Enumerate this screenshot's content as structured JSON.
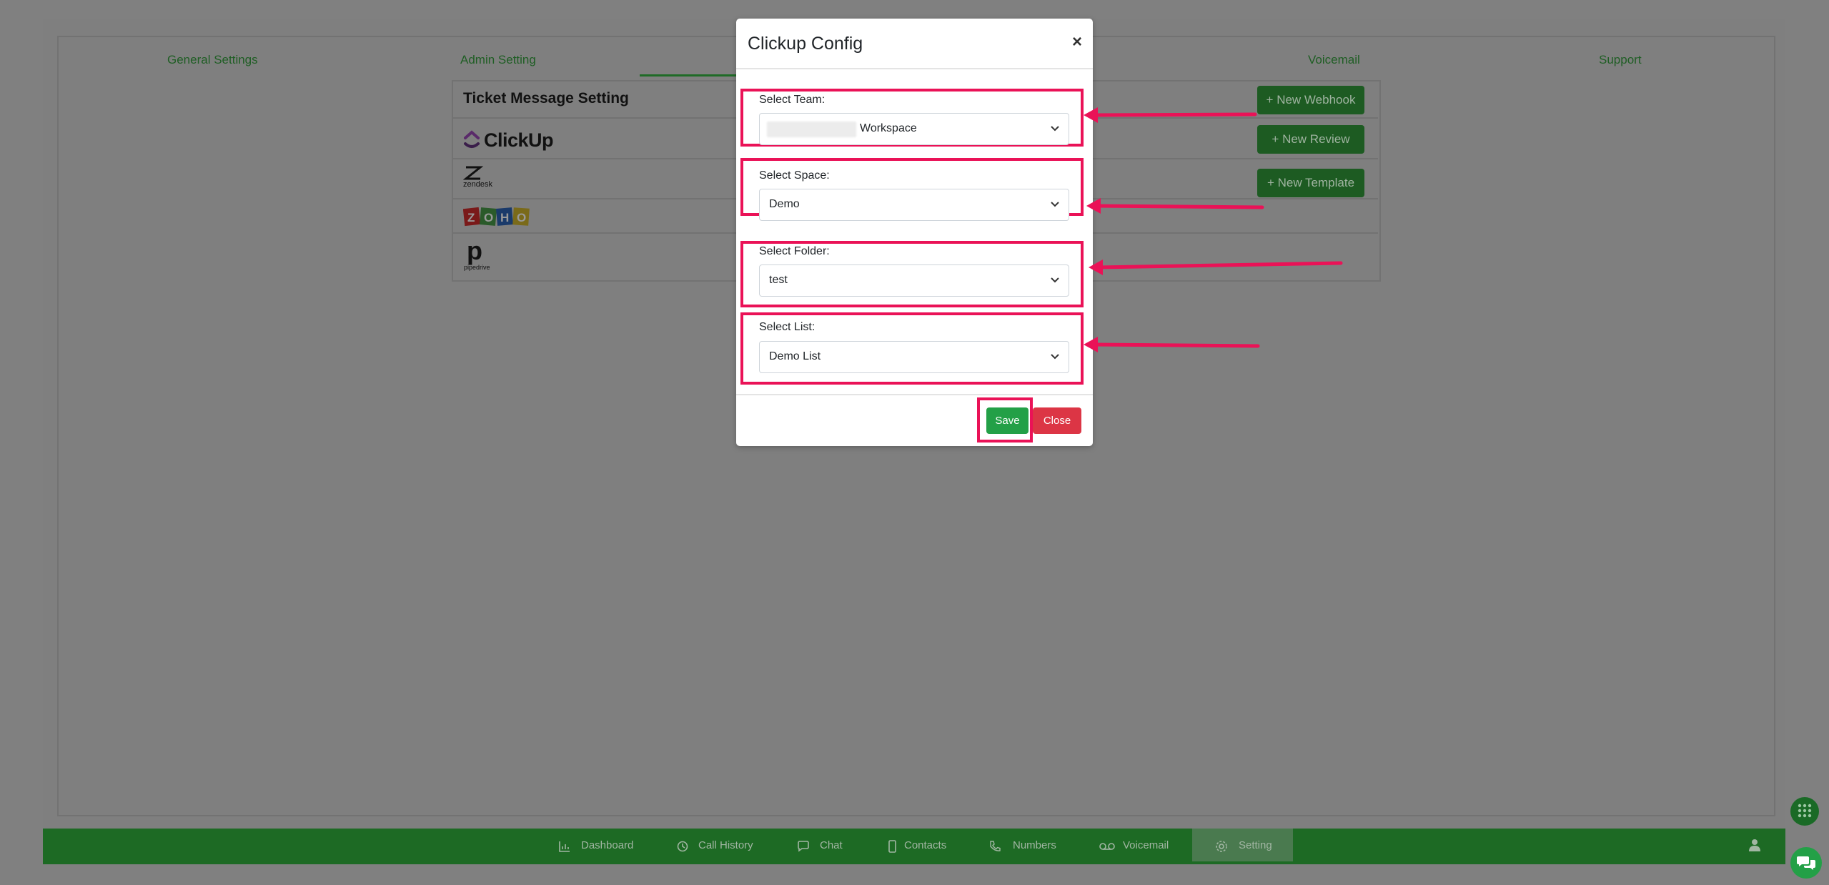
{
  "background_tabs": [
    "General Settings",
    "Admin Setting",
    "Voicemail",
    "Support"
  ],
  "ticket_card": {
    "title": "Ticket Message Setting",
    "integrations": [
      {
        "name": "ClickUp",
        "logo_text": "ClickUp"
      },
      {
        "name": "zendesk",
        "logo_text": "zendesk"
      },
      {
        "name": "ZOHO",
        "logo_text": "ZOHO"
      },
      {
        "name": "pipedrive",
        "logo_text": "pipedrive"
      }
    ]
  },
  "side_buttons": [
    "New Webhook",
    "New Review",
    "New Template"
  ],
  "modal": {
    "title": "Clickup Config",
    "close_symbol": "×",
    "fields": [
      {
        "label": "Select Team:",
        "value": "Workspace",
        "redacted_prefix": true
      },
      {
        "label": "Select Space:",
        "value": "Demo"
      },
      {
        "label": "Select Folder:",
        "value": "test"
      },
      {
        "label": "Select List:",
        "value": "Demo List"
      }
    ],
    "save_label": "Save",
    "close_label": "Close"
  },
  "bottom_nav": {
    "items": [
      {
        "label": "Dashboard",
        "icon": "bar-chart-icon"
      },
      {
        "label": "Call History",
        "icon": "history-icon"
      },
      {
        "label": "Chat",
        "icon": "chat-icon"
      },
      {
        "label": "Contacts",
        "icon": "phone-device-icon"
      },
      {
        "label": "Numbers",
        "icon": "phone-icon"
      },
      {
        "label": "Voicemail",
        "icon": "voicemail-icon"
      },
      {
        "label": "Setting",
        "icon": "gear-icon"
      }
    ],
    "active": "Setting"
  },
  "colors": {
    "highlight": "#ea1257",
    "save": "#23a047",
    "close": "#dc3545",
    "nav_bar": "#1d6a24"
  }
}
